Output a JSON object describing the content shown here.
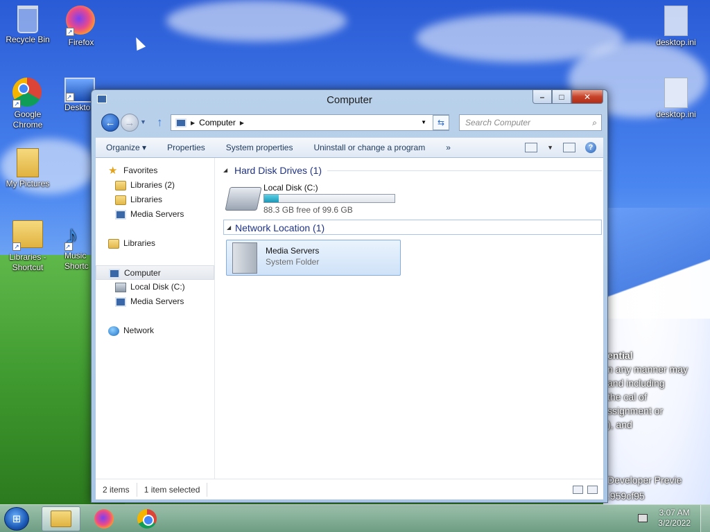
{
  "desktop": {
    "icons": [
      {
        "label": "Recycle Bin"
      },
      {
        "label": "Firefox"
      },
      {
        "label": "Google Chrome"
      },
      {
        "label": "Deskto"
      },
      {
        "label": "My Pictures"
      },
      {
        "label": "Libraries - Shortcut"
      },
      {
        "label": "Music Shortc"
      },
      {
        "label": "desktop.ini"
      },
      {
        "label": "desktop.ini"
      }
    ],
    "wallpaper_text": [
      "ential",
      "n any manner may",
      "and including",
      "the cal  of",
      "ssignment or",
      "  ), and",
      "Developer Previe",
      ".959cf95"
    ]
  },
  "window": {
    "title": "Computer",
    "controls": {
      "minimize": "–",
      "maximize": "□",
      "close": "✕"
    },
    "address": {
      "crumb": "Computer"
    },
    "search": {
      "placeholder": "Search Computer"
    },
    "toolbar": {
      "organize": "Organize ▾",
      "properties": "Properties",
      "system_properties": "System properties",
      "uninstall": "Uninstall or change a program",
      "more": "»"
    },
    "nav": {
      "favorites": "Favorites",
      "fav_items": [
        "Libraries (2)",
        "Libraries",
        "Media Servers"
      ],
      "libraries": "Libraries",
      "computer": "Computer",
      "computer_items": [
        "Local Disk (C:)",
        "Media Servers"
      ],
      "network": "Network"
    },
    "groups": {
      "hard_disk": "Hard Disk Drives (1)",
      "network_location": "Network Location (1)"
    },
    "drive": {
      "name": "Local Disk (C:)",
      "free_text": "88.3 GB free of 99.6 GB",
      "used_fraction": 0.113
    },
    "media": {
      "name": "Media Servers",
      "type": "System Folder"
    },
    "status": {
      "items": "2 items",
      "selected": "1 item selected"
    }
  },
  "taskbar": {
    "clock_time": "3:07 AM",
    "clock_date": "3/2/2022"
  },
  "colors": {
    "accent": "#1e3287",
    "selection": "#cfe2f8",
    "drive_fill": "#1c98b8"
  }
}
